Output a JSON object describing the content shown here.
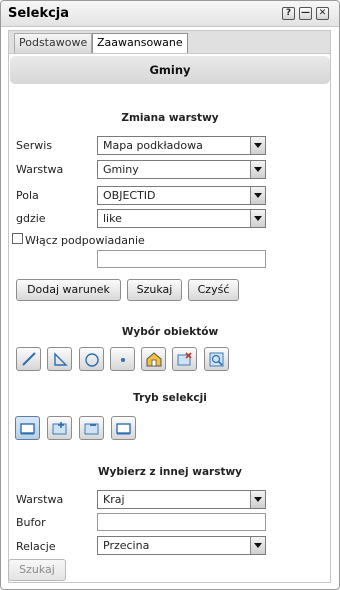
{
  "window": {
    "title": "Selekcja",
    "help_glyph": "?",
    "minimize_glyph": "—",
    "close_glyph": "✕"
  },
  "tabs": [
    {
      "label": "Podstawowe"
    },
    {
      "label": "Zaawansowane"
    }
  ],
  "header": {
    "title": "Gminy"
  },
  "layer_change": {
    "title": "Zmiana warstwy",
    "service_label": "Serwis",
    "service_value": "Mapa podkładowa",
    "layer_label": "Warstwa",
    "layer_value": "Gminy",
    "field_label": "Pola",
    "field_value": "OBJECTID",
    "where_label": "gdzie",
    "where_value": "like",
    "hints_label": "Włącz podpowiadanie",
    "hints_checked": false,
    "value_input": ""
  },
  "actions": {
    "add_condition": "Dodaj warunek",
    "search": "Szukaj",
    "clear": "Czyść"
  },
  "object_selection": {
    "title": "Wybór obiektów",
    "tools": [
      "line-tool-icon",
      "triangle-tool-icon",
      "circle-tool-icon",
      "point-tool-icon",
      "house-select-icon",
      "map-select-icon",
      "map-zoom-select-icon"
    ]
  },
  "selection_mode": {
    "title": "Tryb selekcji",
    "modes": [
      "new-selection-icon",
      "add-selection-icon",
      "remove-selection-icon",
      "intersect-selection-icon"
    ],
    "active_index": 0
  },
  "other_layer": {
    "title": "Wybierz z innej warstwy",
    "layer_label": "Warstwa",
    "layer_value": "Kraj",
    "buffer_label": "Bufor",
    "buffer_value": "",
    "relation_label": "Relacje",
    "relation_value": "Przecina",
    "search_button": "Szukaj"
  },
  "colors": {
    "accent": "#3a7bbf",
    "active_tool": "#b7cfe6"
  }
}
